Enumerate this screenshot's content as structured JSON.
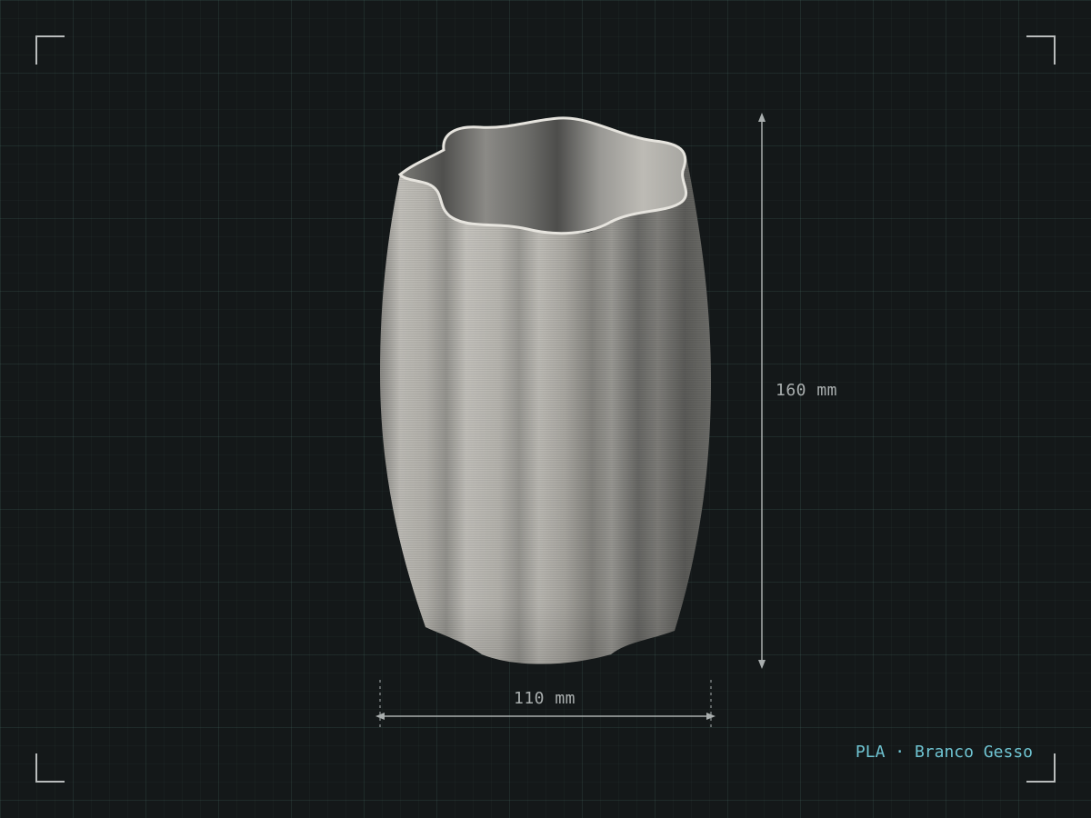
{
  "subject": "3d-printed-vase",
  "dimensions": {
    "height_label": "160 mm",
    "width_label": "110 mm"
  },
  "material_label": "PLA · Branco Gesso",
  "colors": {
    "background": "#141819",
    "grid": "#2a3a36",
    "vase_light": "#c9c7c1",
    "vase_shadow": "#5a5a57",
    "dimension_lines": "#a9aeae",
    "material_text": "#6fc4d2",
    "corner_brackets": "#b9bcbc"
  }
}
